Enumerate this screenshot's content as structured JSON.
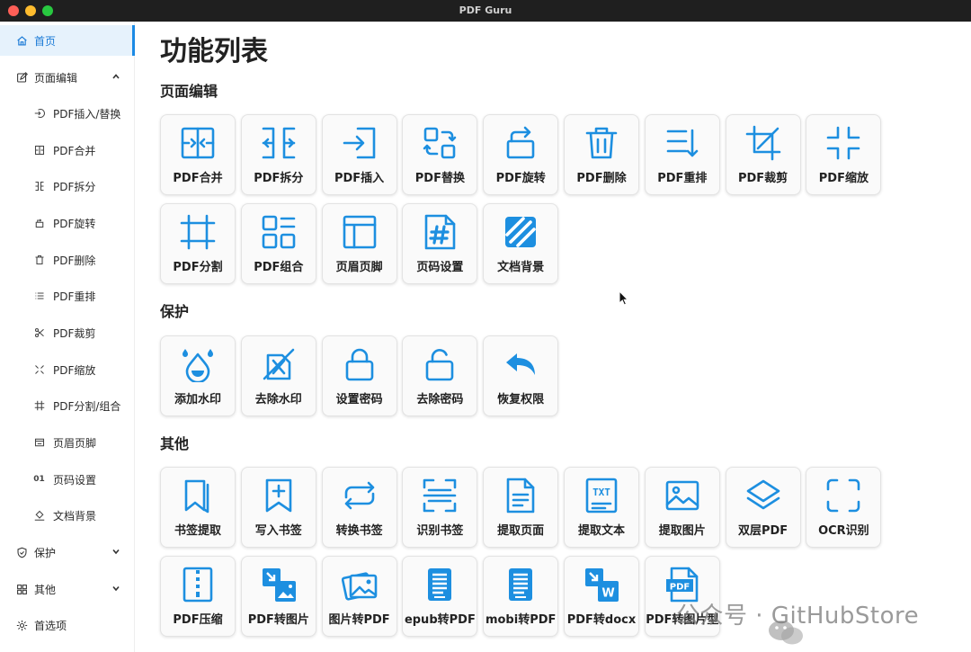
{
  "window": {
    "title": "PDF Guru",
    "traffic_lights": {
      "close": "#ff5f57",
      "minimize": "#febc2e",
      "zoom": "#28c840"
    }
  },
  "sidebar": {
    "home": "首页",
    "page_edit": "页面编辑",
    "sub_items": [
      "PDF插入/替换",
      "PDF合并",
      "PDF拆分",
      "PDF旋转",
      "PDF删除",
      "PDF重排",
      "PDF裁剪",
      "PDF缩放",
      "PDF分割/组合",
      "页眉页脚",
      "页码设置",
      "文档背景"
    ],
    "page_number_icon_text": "01",
    "protect": "保护",
    "other": "其他",
    "preferences": "首选项"
  },
  "main": {
    "title": "功能列表",
    "sections": [
      {
        "title": "页面编辑",
        "tiles": [
          {
            "label": "PDF合并",
            "icon": "merge-icon"
          },
          {
            "label": "PDF拆分",
            "icon": "split-icon"
          },
          {
            "label": "PDF插入",
            "icon": "insert-icon"
          },
          {
            "label": "PDF替换",
            "icon": "replace-icon"
          },
          {
            "label": "PDF旋转",
            "icon": "rotate-icon"
          },
          {
            "label": "PDF删除",
            "icon": "trash-icon"
          },
          {
            "label": "PDF重排",
            "icon": "reorder-icon"
          },
          {
            "label": "PDF裁剪",
            "icon": "crop-icon"
          },
          {
            "label": "PDF缩放",
            "icon": "shrink-icon"
          },
          {
            "label": "PDF分割",
            "icon": "cut-frame-icon"
          },
          {
            "label": "PDF组合",
            "icon": "layout-icon"
          },
          {
            "label": "页眉页脚",
            "icon": "header-footer-icon"
          },
          {
            "label": "页码设置",
            "icon": "page-number-icon"
          },
          {
            "label": "文档背景",
            "icon": "background-icon"
          }
        ]
      },
      {
        "title": "保护",
        "tiles": [
          {
            "label": "添加水印",
            "icon": "watermark-drop-icon"
          },
          {
            "label": "去除水印",
            "icon": "remove-watermark-icon"
          },
          {
            "label": "设置密码",
            "icon": "lock-icon"
          },
          {
            "label": "去除密码",
            "icon": "unlock-icon"
          },
          {
            "label": "恢复权限",
            "icon": "undo-arrow-icon"
          }
        ]
      },
      {
        "title": "其他",
        "tiles": [
          {
            "label": "书签提取",
            "icon": "bookmarks-icon"
          },
          {
            "label": "写入书签",
            "icon": "add-bookmark-icon"
          },
          {
            "label": "转换书签",
            "icon": "convert-icon"
          },
          {
            "label": "识别书签",
            "icon": "scan-icon"
          },
          {
            "label": "提取页面",
            "icon": "document-icon"
          },
          {
            "label": "提取文本",
            "icon": "txt-icon",
            "glyph": "TXT"
          },
          {
            "label": "提取图片",
            "icon": "image-icon"
          },
          {
            "label": "双层PDF",
            "icon": "layers-icon"
          },
          {
            "label": "OCR识别",
            "icon": "ocr-frame-icon"
          },
          {
            "label": "PDF压缩",
            "icon": "zip-icon"
          },
          {
            "label": "PDF转图片",
            "icon": "pdf-to-image-icon"
          },
          {
            "label": "图片转PDF",
            "icon": "images-icon"
          },
          {
            "label": "epub转PDF",
            "icon": "epub-icon"
          },
          {
            "label": "mobi转PDF",
            "icon": "mobi-icon"
          },
          {
            "label": "PDF转docx",
            "icon": "word-icon",
            "glyph": "W"
          },
          {
            "label": "PDF转图片型",
            "icon": "pdf-badge-icon",
            "glyph": "PDF"
          }
        ]
      }
    ]
  },
  "watermark": "公众号 · GitHubStore",
  "colors": {
    "accent": "#1a8ae5",
    "icon": "#1d8fe0",
    "active_bg": "#e6f2fc"
  }
}
